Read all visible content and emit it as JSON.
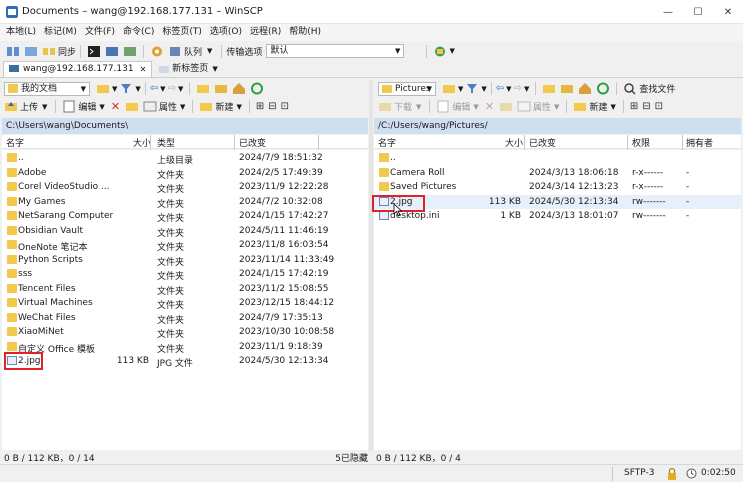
{
  "window": {
    "title": "Documents – wang@192.168.177.131 – WinSCP",
    "min": "—",
    "max": "☐",
    "close": "✕"
  },
  "menu": [
    "本地(L)",
    "标记(M)",
    "文件(F)",
    "命令(C)",
    "标签页(T)",
    "选项(O)",
    "远程(R)",
    "帮助(H)"
  ],
  "toolbar": {
    "sync_label": "同步",
    "queue_label": "队列",
    "transfer_label": "传输选项",
    "transfer_value": "默认"
  },
  "tabs": {
    "session": "wang@192.168.177.131",
    "new_tab": "新标签页"
  },
  "left": {
    "location": "我的文档",
    "upload": "上传",
    "edit": "编辑",
    "properties": "属性",
    "new": "新建",
    "path": "C:\\Users\\wang\\Documents\\",
    "headers": {
      "name": "名字",
      "size": "大小",
      "type": "类型",
      "modified": "已改变"
    },
    "rows": [
      {
        "name": "..",
        "size": "",
        "type": "上级目录",
        "modified": "2024/7/9  18:51:32",
        "icon": "up"
      },
      {
        "name": "Adobe",
        "size": "",
        "type": "文件夹",
        "modified": "2024/2/5  17:49:39",
        "icon": "folder"
      },
      {
        "name": "Corel VideoStudio ...",
        "size": "",
        "type": "文件夹",
        "modified": "2023/11/9  12:22:28",
        "icon": "folder"
      },
      {
        "name": "My Games",
        "size": "",
        "type": "文件夹",
        "modified": "2024/7/2  10:32:08",
        "icon": "folder"
      },
      {
        "name": "NetSarang Computer",
        "size": "",
        "type": "文件夹",
        "modified": "2024/1/15  17:42:27",
        "icon": "folder"
      },
      {
        "name": "Obsidian Vault",
        "size": "",
        "type": "文件夹",
        "modified": "2024/5/11  11:46:19",
        "icon": "folder"
      },
      {
        "name": "OneNote 笔记本",
        "size": "",
        "type": "文件夹",
        "modified": "2023/11/8  16:03:54",
        "icon": "folder"
      },
      {
        "name": "Python Scripts",
        "size": "",
        "type": "文件夹",
        "modified": "2023/11/14  11:33:49",
        "icon": "folder"
      },
      {
        "name": "sss",
        "size": "",
        "type": "文件夹",
        "modified": "2024/1/15  17:42:19",
        "icon": "folder"
      },
      {
        "name": "Tencent Files",
        "size": "",
        "type": "文件夹",
        "modified": "2023/11/2  15:08:55",
        "icon": "folder"
      },
      {
        "name": "Virtual Machines",
        "size": "",
        "type": "文件夹",
        "modified": "2023/12/15  18:44:12",
        "icon": "folder"
      },
      {
        "name": "WeChat Files",
        "size": "",
        "type": "文件夹",
        "modified": "2024/7/9  17:35:13",
        "icon": "folder"
      },
      {
        "name": "XiaoMiNet",
        "size": "",
        "type": "文件夹",
        "modified": "2023/10/30  10:08:58",
        "icon": "folder"
      },
      {
        "name": "自定义 Office 模板",
        "size": "",
        "type": "文件夹",
        "modified": "2023/11/1  9:18:39",
        "icon": "folder"
      },
      {
        "name": "2.jpg",
        "size": "113 KB",
        "type": "JPG 文件",
        "modified": "2024/5/30  12:13:34",
        "icon": "file"
      }
    ],
    "status_left": "0 B / 112 KB，0 / 14",
    "status_right": "5已隐藏"
  },
  "right": {
    "location": "Pictures",
    "download": "下载",
    "edit": "编辑",
    "properties": "属性",
    "new": "新建",
    "find": "查找文件",
    "path": "/C:/Users/wang/Pictures/",
    "headers": {
      "name": "名字",
      "size": "大小",
      "modified": "已改变",
      "perm": "权限",
      "owner": "拥有者"
    },
    "rows": [
      {
        "name": "..",
        "size": "",
        "modified": "",
        "perm": "",
        "owner": "",
        "icon": "up"
      },
      {
        "name": "Camera Roll",
        "size": "",
        "modified": "2024/3/13  18:06:18",
        "perm": "r-x------",
        "owner": "-",
        "icon": "folder"
      },
      {
        "name": "Saved Pictures",
        "size": "",
        "modified": "2024/3/14  12:13:23",
        "perm": "r-x------",
        "owner": "-",
        "icon": "folder"
      },
      {
        "name": "2.jpg",
        "size": "113 KB",
        "modified": "2024/5/30  12:13:34",
        "perm": "rw-------",
        "owner": "-",
        "icon": "file"
      },
      {
        "name": "desktop.ini",
        "size": "1 KB",
        "modified": "2024/3/13  18:01:07",
        "perm": "rw-------",
        "owner": "-",
        "icon": "file"
      }
    ],
    "status_left": "0 B / 112 KB，0 / 4"
  },
  "statusbar": {
    "protocol": "SFTP-3",
    "timer": "0:02:50"
  }
}
